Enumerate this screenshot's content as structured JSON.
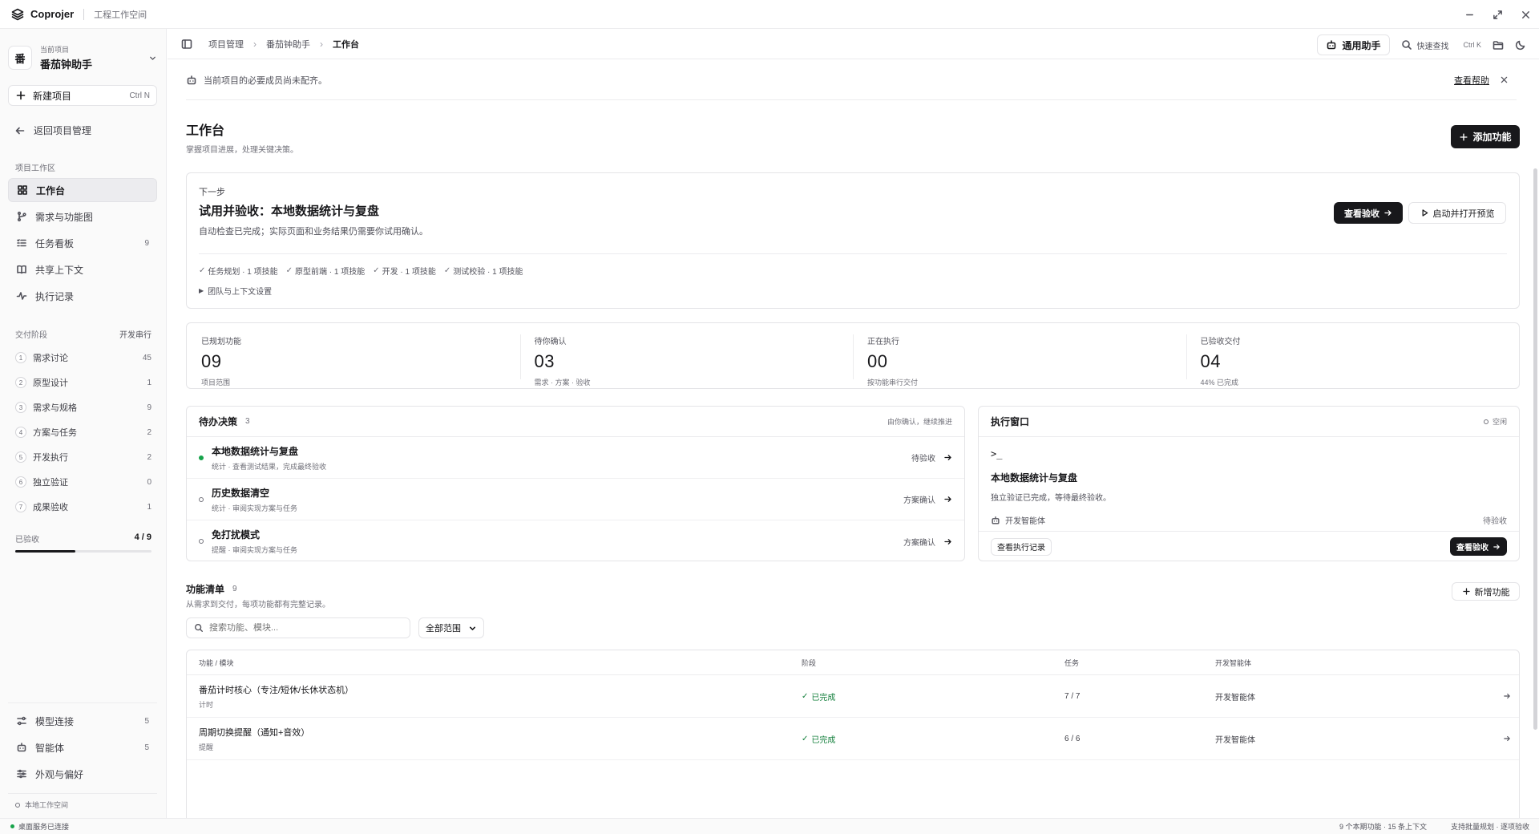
{
  "titlebar": {
    "app_name": "Coprojer",
    "workspace": "工程工作空间"
  },
  "sidebar": {
    "current_label": "当前项目",
    "avatar_char": "番",
    "project_name": "番茄钟助手",
    "new_project": "新建项目",
    "new_project_kbd": "Ctrl N",
    "back": "返回项目管理",
    "workspace_section": "项目工作区",
    "nav": [
      {
        "label": "工作台",
        "count": "",
        "icon": "grid-icon"
      },
      {
        "label": "需求与功能图",
        "count": "",
        "icon": "branch-icon"
      },
      {
        "label": "任务看板",
        "count": "9",
        "icon": "list-check-icon"
      },
      {
        "label": "共享上下文",
        "count": "",
        "icon": "book-icon"
      },
      {
        "label": "执行记录",
        "count": "",
        "icon": "activity-icon"
      }
    ],
    "stages_section": "交付阶段",
    "stages_mode": "开发串行",
    "stages": [
      {
        "num": "1",
        "label": "需求讨论",
        "count": "45"
      },
      {
        "num": "2",
        "label": "原型设计",
        "count": "1"
      },
      {
        "num": "3",
        "label": "需求与规格",
        "count": "9"
      },
      {
        "num": "4",
        "label": "方案与任务",
        "count": "2"
      },
      {
        "num": "5",
        "label": "开发执行",
        "count": "2"
      },
      {
        "num": "6",
        "label": "独立验证",
        "count": "0"
      },
      {
        "num": "7",
        "label": "成果验收",
        "count": "1"
      }
    ],
    "accepted_label": "已验收",
    "accepted_value": "4 / 9",
    "accepted_fraction": 0.444,
    "bottom_nav": [
      {
        "label": "模型连接",
        "count": "5",
        "icon": "sliders-icon"
      },
      {
        "label": "智能体",
        "count": "5",
        "icon": "bot-icon"
      },
      {
        "label": "外观与偏好",
        "count": "",
        "icon": "settings-icon"
      }
    ],
    "local_workspace": "本地工作空间"
  },
  "topbar": {
    "breadcrumb": [
      "项目管理",
      "番茄钟助手",
      "工作台"
    ],
    "assistant": "通用助手",
    "quick_find": "快速查找",
    "quick_find_kbd": "Ctrl K"
  },
  "notice": {
    "text": "当前项目的必要成员尚未配齐。",
    "help": "查看帮助"
  },
  "page": {
    "title": "工作台",
    "subtitle": "掌握项目进展，处理关键决策。",
    "add_feature": "添加功能"
  },
  "next_step": {
    "label": "下一步",
    "title": "试用并验收：本地数据统计与复盘",
    "desc": "自动检查已完成；实际页面和业务结果仍需要你试用确认。",
    "btn_check": "查看验收",
    "btn_preview": "启动并打开预览",
    "skills": [
      "任务规划 · 1 项技能",
      "原型前端 · 1 项技能",
      "开发 · 1 项技能",
      "测试校验 · 1 项技能"
    ],
    "team_toggle": "团队与上下文设置"
  },
  "stats": [
    {
      "label": "已规划功能",
      "value": "09",
      "sub": "项目范围"
    },
    {
      "label": "待你确认",
      "value": "03",
      "sub": "需求 · 方案 · 验收"
    },
    {
      "label": "正在执行",
      "value": "00",
      "sub": "按功能串行交付"
    },
    {
      "label": "已验收交付",
      "value": "04",
      "sub": "44% 已完成"
    }
  ],
  "decisions": {
    "title": "待办决策",
    "count": "3",
    "hint": "由你确认，继续推进",
    "items": [
      {
        "title": "本地数据统计与复盘",
        "sub": "统计 · 查看测试结果，完成最终验收",
        "status": "待验收",
        "active": true
      },
      {
        "title": "历史数据清空",
        "sub": "统计 · 审阅实现方案与任务",
        "status": "方案确认",
        "active": false
      },
      {
        "title": "免打扰模式",
        "sub": "提醒 · 审阅实现方案与任务",
        "status": "方案确认",
        "active": false
      }
    ]
  },
  "exec_window": {
    "title": "执行窗口",
    "state": "空闲",
    "prompt": ">_",
    "task_title": "本地数据统计与复盘",
    "task_desc": "独立验证已完成，等待最终验收。",
    "agent": "开发智能体",
    "agent_status": "待验收",
    "btn_log": "查看执行记录",
    "btn_check": "查看验收"
  },
  "features": {
    "title": "功能清单",
    "count": "9",
    "subtitle": "从需求到交付，每项功能都有完整记录。",
    "new_btn": "新增功能",
    "search_placeholder": "搜索功能、模块...",
    "scope": "全部范围",
    "columns": [
      "功能 / 模块",
      "阶段",
      "任务",
      "开发智能体"
    ],
    "rows": [
      {
        "name": "番茄计时核心（专注/短休/长休状态机）",
        "module": "计时",
        "stage": "已完成",
        "tasks": "7 / 7",
        "agent": "开发智能体"
      },
      {
        "name": "周期切换提醒（通知+音效）",
        "module": "提醒",
        "stage": "已完成",
        "tasks": "6 / 6",
        "agent": "开发智能体"
      }
    ]
  },
  "statusbar": {
    "left": "桌面服务已连接",
    "right1": "9 个本期功能 · 15 条上下文",
    "right2": "支持批量规划 · 逐项验收"
  }
}
